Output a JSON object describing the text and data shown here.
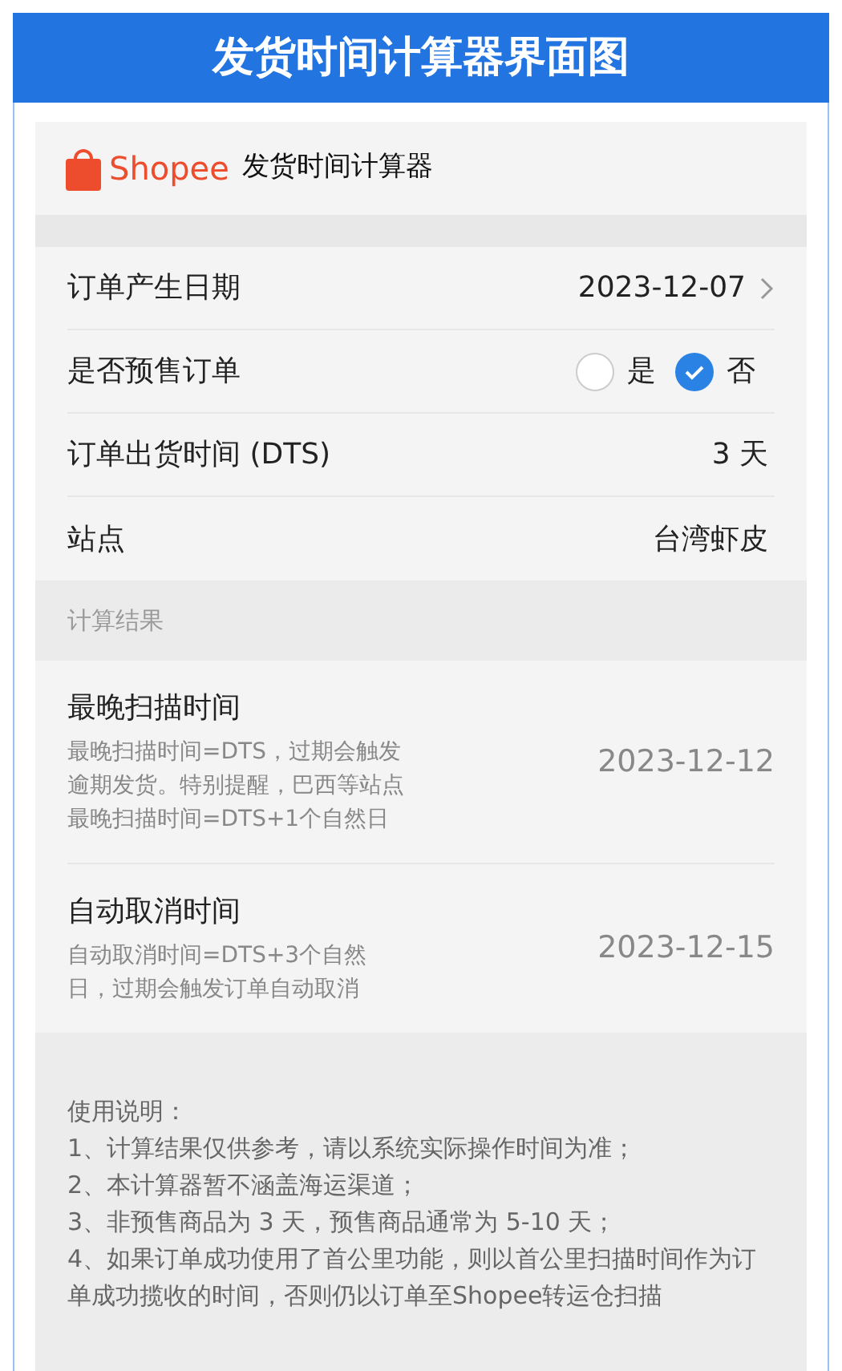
{
  "banner": {
    "title": "发货时间计算器界面图"
  },
  "app": {
    "logo_text": "Shopee",
    "title": "发货时间计算器"
  },
  "form_rows": [
    {
      "kind": "select",
      "label": "订单产生日期",
      "value": "2023-12-07"
    },
    {
      "kind": "radio",
      "label": "是否预售订单",
      "options": [
        {
          "label": "是",
          "selected": false
        },
        {
          "label": "否",
          "selected": true
        }
      ]
    },
    {
      "kind": "text",
      "label": "订单出货时间 (DTS)",
      "value": "3 天"
    },
    {
      "kind": "text",
      "label": "站点",
      "value": "台湾虾皮"
    }
  ],
  "results_section": {
    "title": "计算结果"
  },
  "results": [
    {
      "title": "最晚扫描时间",
      "description": "最晚扫描时间=DTS，过期会触发逾期发货。特别提醒，巴西等站点最晚扫描时间=DTS+1个自然日",
      "value": "2023-12-12"
    },
    {
      "title": "自动取消时间",
      "description": "自动取消时间=DTS+3个自然日，过期会触发订单自动取消",
      "value": "2023-12-15"
    }
  ],
  "instructions": {
    "heading": "使用说明：",
    "items": [
      "1、计算结果仅供参考，请以系统实际操作时间为准；",
      "2、本计算器暂不涵盖海运渠道；",
      "3、非预售商品为 3 天，预售商品通常为 5-10 天；",
      "4、如果订单成功使用了首公里功能，则以首公里扫描时间作为订单成功揽收的时间，否则仍以订单至Shopee转运仓扫描"
    ]
  }
}
